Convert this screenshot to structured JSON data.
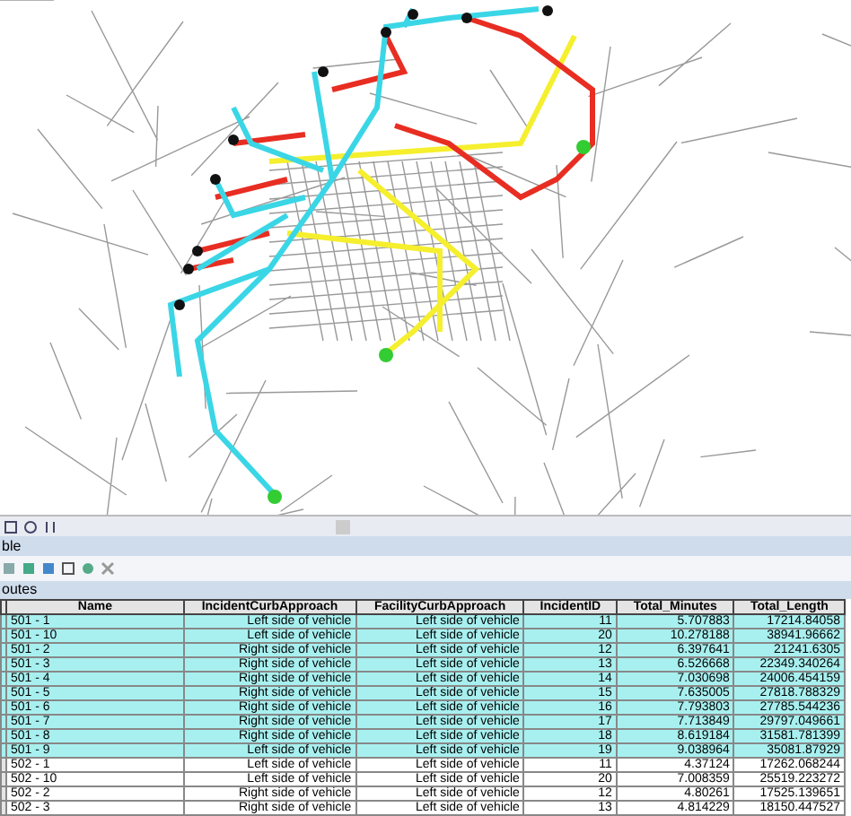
{
  "window": {
    "title": "ble"
  },
  "tabs": [
    {
      "label": "outes",
      "selected": true
    }
  ],
  "table": {
    "columns": [
      "Name",
      "IncidentCurbApproach",
      "FacilityCurbApproach",
      "IncidentID",
      "Total_Minutes",
      "Total_Length"
    ],
    "rows": [
      {
        "cells": [
          "501 - 1",
          "Left side of vehicle",
          "Left side of vehicle",
          "11",
          "5.707883",
          "17214.84058"
        ],
        "selected": true
      },
      {
        "cells": [
          "501 - 10",
          "Left side of vehicle",
          "Left side of vehicle",
          "20",
          "10.278188",
          "38941.96662"
        ],
        "selected": true
      },
      {
        "cells": [
          "501 - 2",
          "Right side of vehicle",
          "Left side of vehicle",
          "12",
          "6.397641",
          "21241.6305"
        ],
        "selected": true
      },
      {
        "cells": [
          "501 - 3",
          "Right side of vehicle",
          "Left side of vehicle",
          "13",
          "6.526668",
          "22349.340264"
        ],
        "selected": true
      },
      {
        "cells": [
          "501 - 4",
          "Right side of vehicle",
          "Left side of vehicle",
          "14",
          "7.030698",
          "24006.454159"
        ],
        "selected": true
      },
      {
        "cells": [
          "501 - 5",
          "Right side of vehicle",
          "Left side of vehicle",
          "15",
          "7.635005",
          "27818.788329"
        ],
        "selected": true
      },
      {
        "cells": [
          "501 - 6",
          "Right side of vehicle",
          "Left side of vehicle",
          "16",
          "7.793803",
          "27785.544236"
        ],
        "selected": true
      },
      {
        "cells": [
          "501 - 7",
          "Right side of vehicle",
          "Left side of vehicle",
          "17",
          "7.713849",
          "29797.049661"
        ],
        "selected": true
      },
      {
        "cells": [
          "501 - 8",
          "Right side of vehicle",
          "Left side of vehicle",
          "18",
          "8.619184",
          "31581.781399"
        ],
        "selected": true
      },
      {
        "cells": [
          "501 - 9",
          "Left side of vehicle",
          "Left side of vehicle",
          "19",
          "9.038964",
          "35081.87929"
        ],
        "selected": true
      },
      {
        "cells": [
          "502 - 1",
          "Left side of vehicle",
          "Left side of vehicle",
          "11",
          "4.37124",
          "17262.068244"
        ],
        "selected": false
      },
      {
        "cells": [
          "502 - 10",
          "Left side of vehicle",
          "Left side of vehicle",
          "20",
          "7.008359",
          "25519.223272"
        ],
        "selected": false
      },
      {
        "cells": [
          "502 - 2",
          "Right side of vehicle",
          "Left side of vehicle",
          "12",
          "4.80261",
          "17525.139651"
        ],
        "selected": false
      },
      {
        "cells": [
          "502 - 3",
          "Right side of vehicle",
          "Left side of vehicle",
          "13",
          "4.814229",
          "18150.447527"
        ],
        "selected": false
      }
    ]
  }
}
